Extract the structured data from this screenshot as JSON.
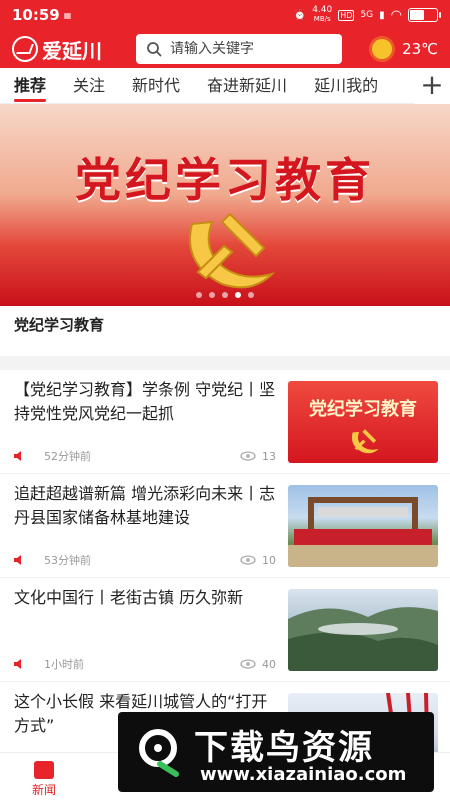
{
  "status_bar": {
    "time": "10:59",
    "speed": "4.40",
    "speed_unit": "MB/s",
    "hd": "HD",
    "network": "5G",
    "battery_level": 0.55
  },
  "header": {
    "logo_text": "爱延川",
    "search_placeholder": "请输入关键字",
    "temperature": "23℃",
    "weather_icon": "sun-icon"
  },
  "tabs": [
    {
      "label": "推荐",
      "active": true
    },
    {
      "label": "关注",
      "active": false
    },
    {
      "label": "新时代",
      "active": false
    },
    {
      "label": "奋进新延川",
      "active": false
    },
    {
      "label": "延川我的",
      "active": false
    }
  ],
  "add_tab_icon": "plus-icon",
  "banner": {
    "title": "党纪学习教育",
    "caption": "党纪学习教育",
    "slide_count": 5,
    "active_slide": 4
  },
  "news": [
    {
      "title": "【党纪学习教育】学条例 守党纪丨坚持党性党风党纪一起抓",
      "time": "52分钟前",
      "views": "13",
      "thumb_text": "党纪学习教育"
    },
    {
      "title": "追赶超越谱新篇 增光添彩向未来丨志丹县国家储备林基地建设",
      "time": "53分钟前",
      "views": "10"
    },
    {
      "title": "文化中国行丨老街古镇 历久弥新",
      "time": "1小时前",
      "views": "40"
    },
    {
      "title": "这个小长假 来看延川城管人的“打开方式”",
      "time": "",
      "views": ""
    }
  ],
  "bottom_nav": [
    {
      "label": "新闻",
      "active": true
    }
  ],
  "watermark": {
    "cn": "下载鸟资源",
    "url": "www.xiazainiao.com"
  },
  "colors": {
    "brand_red": "#e8232a",
    "sun": "#f6c42a"
  }
}
